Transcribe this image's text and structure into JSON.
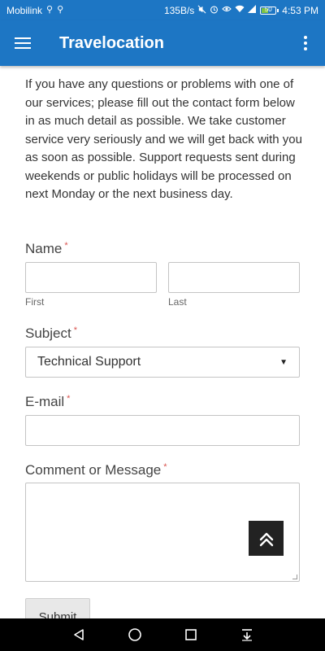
{
  "status_bar": {
    "carrier": "Mobilink",
    "speed": "135B/s",
    "battery": "50",
    "battery_level": 0.5,
    "time": "4:53 PM",
    "icons": [
      "usb-icon",
      "usb-icon",
      "mute-icon",
      "alarm-icon",
      "eye-icon",
      "wifi-icon",
      "signal-icon",
      "battery-icon"
    ]
  },
  "app_bar": {
    "title": "Travelocation",
    "color": "#1d76c4"
  },
  "intro_text": "If you have any questions or problems with one of our services; please fill out the contact form below in as much detail as possible. We take customer service very seriously and we will get back with you as soon as possible. Support requests sent during weekends or public holidays will be processed on next Monday or the next business day.",
  "form": {
    "required_marker": "*",
    "name": {
      "label": "Name",
      "first_label": "First",
      "last_label": "Last",
      "first_value": "",
      "last_value": ""
    },
    "subject": {
      "label": "Subject",
      "selected": "Technical Support"
    },
    "email": {
      "label": "E-mail",
      "value": ""
    },
    "message": {
      "label": "Comment or Message",
      "value": ""
    },
    "submit_label": "Submit"
  }
}
